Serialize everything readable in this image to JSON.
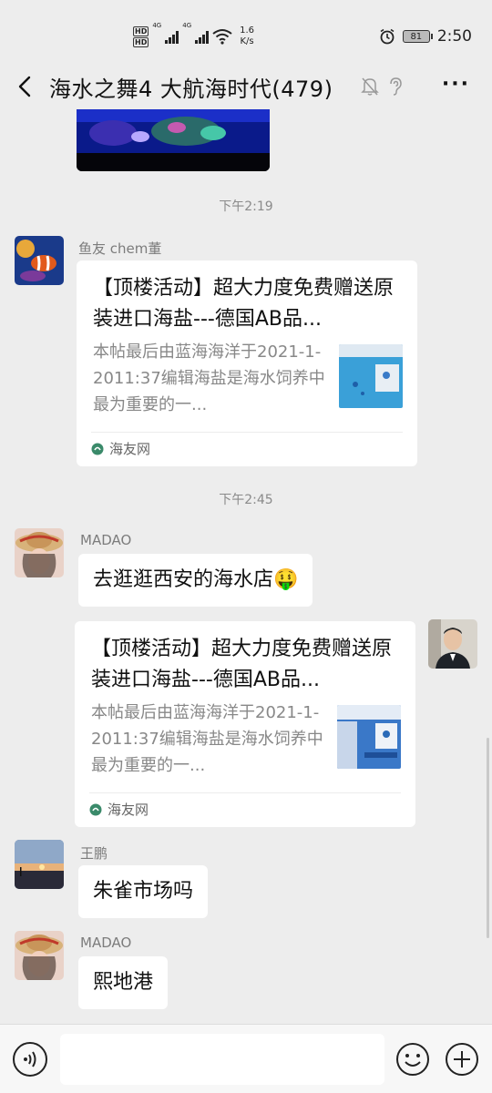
{
  "status_bar": {
    "hd1": "HD",
    "hd2": "HD",
    "net1": "4G",
    "net2": "4G",
    "speed_value": "1.6",
    "speed_unit": "K/s",
    "battery": "81",
    "time": "2:50",
    "icons": [
      "alarm-icon",
      "wifi-icon",
      "signal-icon",
      "battery-icon"
    ]
  },
  "header": {
    "title": "海水之舞4 大航海时代(479)",
    "icons": [
      "back-icon",
      "mute-icon",
      "ear-icon",
      "more-icon"
    ],
    "more_label": "···"
  },
  "chat": {
    "timestamps": [
      "下午2:19",
      "下午2:45"
    ],
    "messages": [
      {
        "sender": "鱼友 chem董",
        "type": "link-card",
        "card": {
          "title": "【顶楼活动】超大力度免费赠送原装进口海盐---德国AB品...",
          "desc": "本帖最后由蓝海海洋于2021-1-2011:37编辑海盐是海水饲养中最为重要的一...",
          "source": "海友网"
        }
      },
      {
        "sender": "MADAO",
        "type": "text",
        "text": "去逛逛西安的海水店🤑"
      },
      {
        "sender": "",
        "type": "link-card",
        "from_self": true,
        "card": {
          "title": "【顶楼活动】超大力度免费赠送原装进口海盐---德国AB品...",
          "desc": "本帖最后由蓝海海洋于2021-1-2011:37编辑海盐是海水饲养中最为重要的一...",
          "source": "海友网"
        }
      },
      {
        "sender": "王鹏",
        "type": "text",
        "text": "朱雀市场吗"
      },
      {
        "sender": "MADAO",
        "type": "text",
        "text": "熙地港"
      }
    ]
  },
  "input_bar": {
    "placeholder": "",
    "icons": [
      "voice-icon",
      "emoji-icon",
      "plus-icon"
    ]
  },
  "colors": {
    "background": "#ededed",
    "bubble": "#ffffff",
    "timestamp": "#8a8a8a",
    "sender": "#7c7c7c"
  }
}
